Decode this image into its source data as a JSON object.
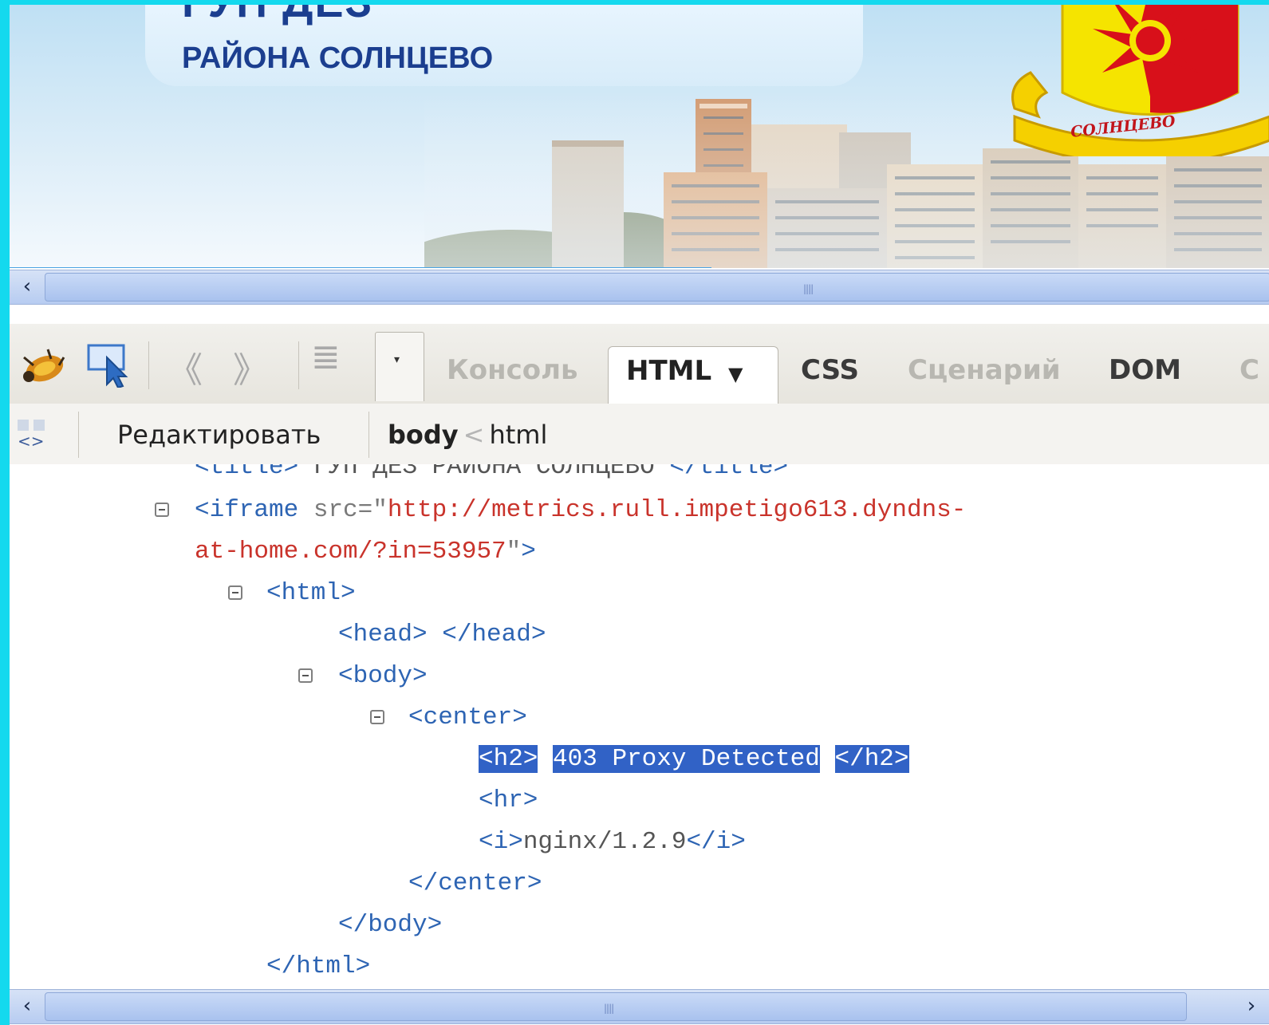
{
  "site": {
    "title_top": "ГУП ДЕЗ",
    "title_sub": "РАЙОНА СОЛНЦЕВО",
    "emblem_text": "СОЛНЦЕВО"
  },
  "toolbar": {
    "tabs": [
      {
        "label": "Консоль",
        "active": false
      },
      {
        "label": "HTML",
        "active": true
      },
      {
        "label": "CSS",
        "active": false
      },
      {
        "label": "Сценарий",
        "active": false
      },
      {
        "label": "DOM",
        "active": false
      },
      {
        "label": "C",
        "active": false
      }
    ],
    "active_tab_arrow": "▼",
    "drop_arrow": "▾"
  },
  "breadcrumb": {
    "edit_label": "Редактировать",
    "current": "body",
    "separator": "<",
    "parent": "html"
  },
  "tree": {
    "title_line": {
      "open": "<title>",
      "text": " ГУП ДЕЗ РАЙОНА СОЛНЦЕВО ",
      "close": "</title>"
    },
    "iframe_open": "<iframe",
    "iframe_attr": " src=",
    "iframe_q1": "\"",
    "iframe_src_1": "http://metrics.rull.impetigo613.dyndns-",
    "iframe_src_2": "at-home.com/?in=53957",
    "iframe_q2": "\"",
    "iframe_end": ">",
    "html_open": "<html>",
    "head_open": "<head>",
    "head_close": "</head>",
    "body_open": "<body>",
    "center_open": "<center>",
    "h2_open": "<h2>",
    "h2_text": "403 Proxy Detected",
    "h2_close": "</h2>",
    "hr": "<hr>",
    "i_open": "<i>",
    "i_text": "nginx/1.2.9",
    "i_close": "</i>",
    "center_close": "</center>",
    "body_close": "</body>",
    "html_close": "</html>"
  },
  "colors": {
    "outer_border": "#14d9ee",
    "tag_blue": "#2d64b3",
    "attr_value_red": "#c9332b",
    "selection": "#3162c6",
    "scrollbar": "#b7ccf1"
  },
  "icons": [
    "firebug-icon",
    "inspect-icon",
    "back-icon",
    "forward-icon",
    "menu-icon",
    "dropdown-icon",
    "toggle-view-icon",
    "collapse-icon",
    "scroll-left-icon",
    "scroll-right-icon"
  ]
}
